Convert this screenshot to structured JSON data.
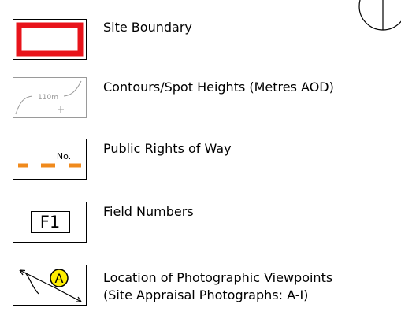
{
  "legend": {
    "items": [
      {
        "key": "site_boundary",
        "label": "Site Boundary"
      },
      {
        "key": "contours",
        "label": "Contours/Spot Heights (Metres AOD)",
        "sample_text": "110m"
      },
      {
        "key": "rights_of_way",
        "label": "Public Rights of Way",
        "sample_text": "No."
      },
      {
        "key": "field_numbers",
        "label": "Field Numbers",
        "sample_text": "F1"
      },
      {
        "key": "viewpoints",
        "label_line1": "Location of Photographic Viewpoints",
        "label_line2": "(Site Appraisal Photographs: A-I)",
        "sample_text": "A"
      }
    ]
  },
  "colors": {
    "site_boundary_red": "#e8141b",
    "contour_grey": "#9a9a9a",
    "right_of_way_orange": "#f08a1c",
    "viewpoint_yellow": "#ffee00"
  },
  "icons": {
    "north_arrow": "north-arrow-icon"
  }
}
